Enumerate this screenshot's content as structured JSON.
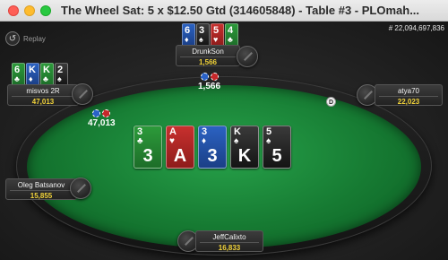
{
  "window": {
    "title": "The Wheel Sat: 5 x $12.50 Gtd  (314605848) - Table #3 - PLOmah..."
  },
  "toolbar": {
    "replay_label": "Replay"
  },
  "hand_id": "# 22,094,697,836",
  "dealer_button": "D",
  "colors": {
    "felt": "#1e8a3b",
    "stack": "#f2d33a",
    "green_suit": "#1d6e29",
    "red_suit": "#8e1c1b",
    "blue_suit": "#1b3f86",
    "black_suit": "#141414"
  },
  "pot": {
    "amount": "47,013"
  },
  "board": [
    {
      "rank": "3",
      "suit": "♣",
      "color": "green"
    },
    {
      "rank": "A",
      "suit": "♥",
      "color": "red"
    },
    {
      "rank": "3",
      "suit": "♦",
      "color": "blue"
    },
    {
      "rank": "K",
      "suit": "♠",
      "color": "black"
    },
    {
      "rank": "5",
      "suit": "♠",
      "color": "black"
    }
  ],
  "players": {
    "top": {
      "name": "DrunkSon",
      "stack": "1,566",
      "bet": "1,566",
      "cards": [
        {
          "rank": "6",
          "suit": "♦",
          "color": "blue"
        },
        {
          "rank": "3",
          "suit": "♠",
          "color": "black"
        },
        {
          "rank": "5",
          "suit": "♥",
          "color": "red"
        },
        {
          "rank": "4",
          "suit": "♣",
          "color": "green"
        }
      ]
    },
    "left_top": {
      "name": "misvos 2R",
      "stack": "47,013",
      "cards": [
        {
          "rank": "6",
          "suit": "♣",
          "color": "green"
        },
        {
          "rank": "K",
          "suit": "♦",
          "color": "blue"
        },
        {
          "rank": "K",
          "suit": "♣",
          "color": "green"
        },
        {
          "rank": "2",
          "suit": "♠",
          "color": "black"
        }
      ]
    },
    "right_top": {
      "name": "atya70",
      "stack": "22,023"
    },
    "left_bottom": {
      "name": "Oleg Batsanov",
      "stack": "15,855"
    },
    "bottom": {
      "name": "JeffCalixto",
      "stack": "16,833"
    }
  }
}
